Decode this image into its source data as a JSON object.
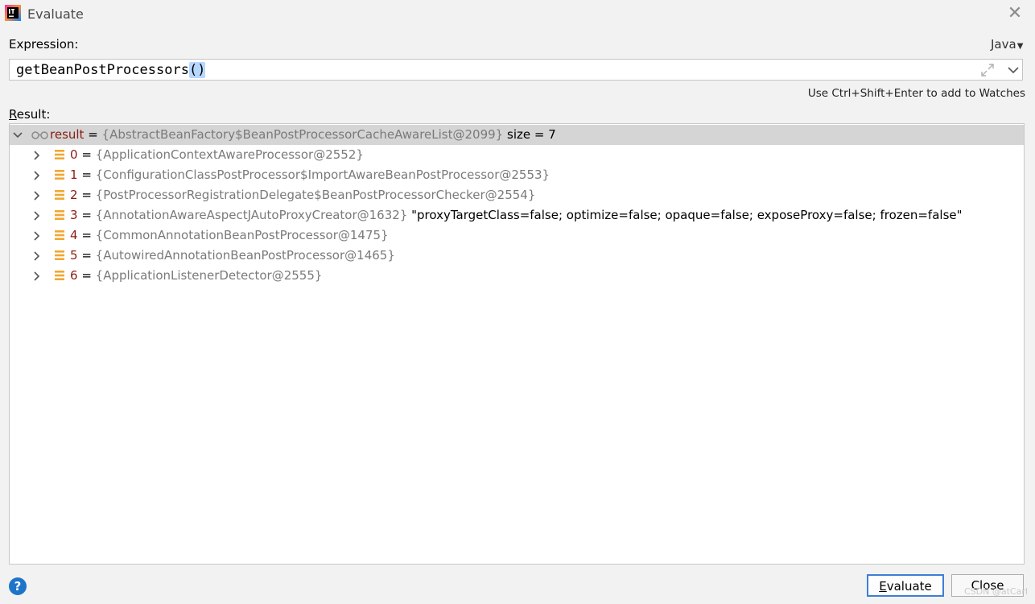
{
  "window": {
    "title": "Evaluate"
  },
  "expression": {
    "label": "Expression:",
    "language": "Java",
    "text_main": "getBeanPostProcessors",
    "text_highlight": "()",
    "hint": "Use Ctrl+Shift+Enter to add to Watches"
  },
  "result": {
    "label": "Result:",
    "root": {
      "name": "result",
      "eq": " = ",
      "value": "{AbstractBeanFactory$BeanPostProcessorCacheAwareList@2099}",
      "extra": " size = 7"
    },
    "items": [
      {
        "index": "0",
        "eq": " = ",
        "value": "{ApplicationContextAwareProcessor@2552}",
        "extra": ""
      },
      {
        "index": "1",
        "eq": " = ",
        "value": "{ConfigurationClassPostProcessor$ImportAwareBeanPostProcessor@2553}",
        "extra": ""
      },
      {
        "index": "2",
        "eq": " = ",
        "value": "{PostProcessorRegistrationDelegate$BeanPostProcessorChecker@2554}",
        "extra": ""
      },
      {
        "index": "3",
        "eq": " = ",
        "value": "{AnnotationAwareAspectJAutoProxyCreator@1632}",
        "extra": " \"proxyTargetClass=false; optimize=false; opaque=false; exposeProxy=false; frozen=false\""
      },
      {
        "index": "4",
        "eq": " = ",
        "value": "{CommonAnnotationBeanPostProcessor@1475}",
        "extra": ""
      },
      {
        "index": "5",
        "eq": " = ",
        "value": "{AutowiredAnnotationBeanPostProcessor@1465}",
        "extra": ""
      },
      {
        "index": "6",
        "eq": " = ",
        "value": "{ApplicationListenerDetector@2555}",
        "extra": ""
      }
    ]
  },
  "footer": {
    "help": "?",
    "evaluate_label": "Evaluate",
    "close_label": "Close",
    "watermark": "CSDN @atCarl"
  },
  "colors": {
    "accent": "#3d7fd6",
    "selection": "#b6d7ff",
    "root_row": "#d5d5d5",
    "help_icon": "#1e74c9"
  }
}
